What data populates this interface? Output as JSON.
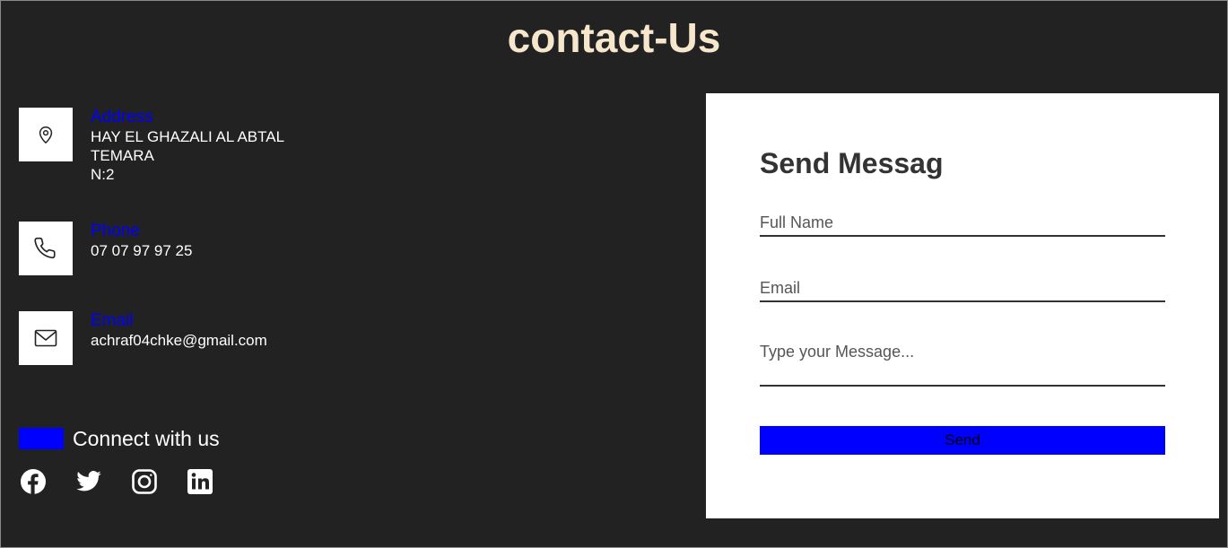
{
  "header": {
    "title": "contact-Us"
  },
  "contact": {
    "address": {
      "label": "Address",
      "lines": [
        "HAY EL GHAZALI AL ABTAL",
        "TEMARA",
        "N:2"
      ],
      "icon": "map-pin-icon"
    },
    "phone": {
      "label": "Phone",
      "value": "07 07 97 97 25",
      "icon": "phone-icon"
    },
    "email": {
      "label": "Email",
      "value": "achraf04chke@gmail.com",
      "icon": "mail-icon"
    }
  },
  "connect": {
    "label": "Connect with us",
    "socials": [
      "facebook-icon",
      "twitter-icon",
      "instagram-icon",
      "linkedin-icon"
    ]
  },
  "form": {
    "title": "Send Messag",
    "full_name_placeholder": "Full Name",
    "email_placeholder": "Email",
    "message_placeholder": "Type your Message...",
    "send_label": "Send"
  },
  "colors": {
    "background": "#222222",
    "title": "#f5e6cc",
    "accent": "#0000ff",
    "card": "#ffffff"
  }
}
